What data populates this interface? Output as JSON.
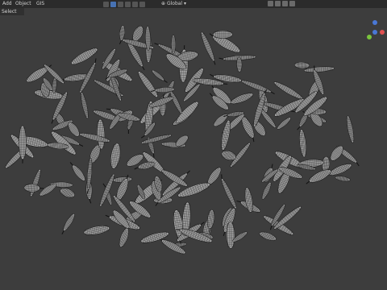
{
  "header": {
    "menu": [
      "Add",
      "Object"
    ],
    "menu_extra": "GIS",
    "global_label": "Global"
  },
  "subbar": {
    "select_label": "Select Box"
  },
  "viewport": {
    "background_color": "#3d3d3d",
    "object_description": "Corn cob scattering (wireframe)"
  },
  "gizmo": {
    "axes": [
      "x",
      "y",
      "z"
    ]
  }
}
